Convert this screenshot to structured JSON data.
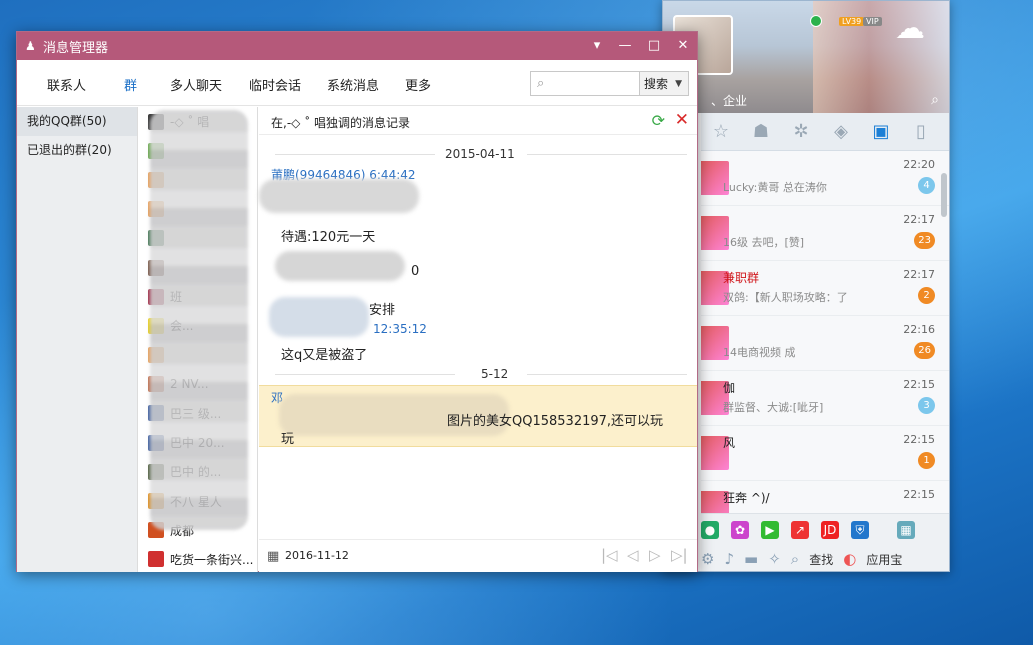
{
  "window": {
    "title": "消息管理器",
    "controls": {
      "menu": "▾",
      "minimize": "—",
      "maximize": "□",
      "close": "✕"
    }
  },
  "nav": {
    "items": [
      "联系人",
      "群",
      "多人聊天",
      "临时会话",
      "系统消息",
      "更多"
    ],
    "active": "群",
    "search_placeholder": "",
    "search_button": "搜索"
  },
  "sidebar": {
    "items": [
      {
        "label": "我的QQ群(50)",
        "active": true
      },
      {
        "label": "已退出的群(20)",
        "active": false
      }
    ]
  },
  "group_list": {
    "items": [
      {
        "name": "-◇ ˚ 唱",
        "color": "#3a3a3a"
      },
      {
        "name": "",
        "color": "#6aa84f"
      },
      {
        "name": "",
        "color": "#e8a05c"
      },
      {
        "name": "",
        "color": "#e8a05c"
      },
      {
        "name": "",
        "color": "#4a7a5a"
      },
      {
        "name": "",
        "color": "#7a5a4a"
      },
      {
        "name": "班",
        "color": "#a0304a"
      },
      {
        "name": "会...",
        "color": "#e8d020"
      },
      {
        "name": "",
        "color": "#e8a05c"
      },
      {
        "name": "2 NV...",
        "color": "#c07050"
      },
      {
        "name": "巴三 级...",
        "color": "#4060a0"
      },
      {
        "name": "巴中 20...",
        "color": "#4060a0"
      },
      {
        "name": "巴中 的...",
        "color": "#506040"
      },
      {
        "name": "不八 星人",
        "color": "#e09020"
      },
      {
        "name": "成都",
        "color": "#d05020"
      },
      {
        "name": "吃货一条街兴...",
        "color": "#d03030"
      }
    ]
  },
  "chat": {
    "header_title": "在,-◇ ˚ 唱独调的消息记录",
    "date1": "2015-04-11",
    "sender1": "莆鹏(99464846) 6:44:42",
    "line1": "待遇:120元一天",
    "line2": "0",
    "line3": "安排",
    "time2": "12:35:12",
    "line4": "这q又是被盗了",
    "date2": "5-12",
    "sender_hl": "邓",
    "hl_line1": "图片的美女QQ158532197,还可以玩",
    "hl_line2": "玩",
    "footer_date": "2016-11-12",
    "pager": {
      "first": "|◁",
      "prev": "◁",
      "next": "▷",
      "last": "▷|"
    }
  },
  "qq_panel": {
    "level_badge": "LV39",
    "vip_badge": "VIP",
    "search_row": "、企业",
    "conversations": [
      {
        "name": "",
        "preview": "Lucky:黄哥 总在涛你",
        "time": "22:20",
        "count": "4",
        "badge": "blue",
        "red": false
      },
      {
        "name": "",
        "preview": "16级 去吧，[赞]",
        "time": "22:17",
        "count": "23",
        "badge": "orange",
        "red": false
      },
      {
        "name": "兼职群",
        "preview": "双鸽:【新人职场攻略：了",
        "time": "22:17",
        "count": "2",
        "badge": "orange",
        "red": true
      },
      {
        "name": "",
        "preview": "14电商视频 成",
        "time": "22:16",
        "count": "26",
        "badge": "orange",
        "red": false
      },
      {
        "name": "伽",
        "preview": "群监督、大诚:[呲牙]",
        "time": "22:15",
        "count": "3",
        "badge": "blue",
        "red": false
      },
      {
        "name": "风",
        "preview": "",
        "time": "22:15",
        "count": "1",
        "badge": "orange",
        "red": false
      },
      {
        "name": "狂奔 ^)/",
        "preview": "",
        "time": "22:15",
        "count": "",
        "badge": "orange",
        "red": false
      }
    ],
    "bottom": {
      "find": "查找",
      "app_store": "应用宝"
    }
  }
}
